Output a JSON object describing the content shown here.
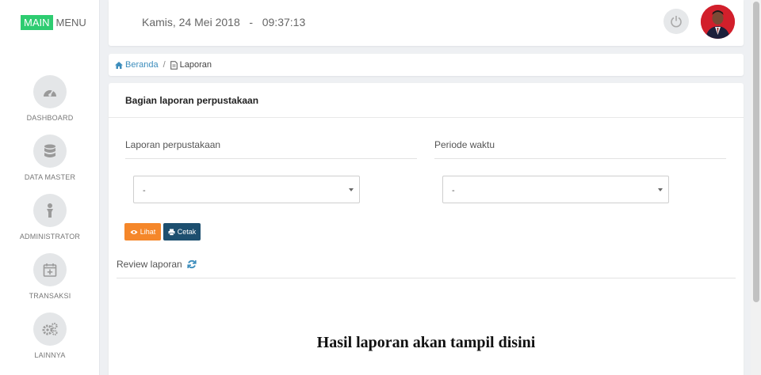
{
  "brand": {
    "main": "MAIN",
    "menu": "MENU"
  },
  "sidebar": {
    "items": [
      {
        "label": "DASHBOARD",
        "icon": "dashboard-gauge-icon"
      },
      {
        "label": "DATA MASTER",
        "icon": "database-icon"
      },
      {
        "label": "ADMINISTRATOR",
        "icon": "user-icon"
      },
      {
        "label": "TRANSAKSI",
        "icon": "calendar-plus-icon"
      },
      {
        "label": "LAINNYA",
        "icon": "gears-icon"
      }
    ]
  },
  "header": {
    "datetime": "Kamis, 24 Mei 2018   -   09:37:13"
  },
  "breadcrumb": {
    "home": "Beranda",
    "separator": "/",
    "current": "Laporan"
  },
  "panel": {
    "title": "Bagian laporan perpustakaan",
    "report_label": "Laporan perpustakaan",
    "report_value": "-",
    "period_label": "Periode waktu",
    "period_value": "-",
    "btn_lihat": "Lihat",
    "btn_cetak": "Cetak",
    "review_label": "Review laporan",
    "result_text": "Hasil laporan akan tampil disini"
  },
  "colors": {
    "brand_green": "#2ecc71",
    "link_blue": "#3c8dbc",
    "lihat_orange": "#f5872a",
    "cetak_navy": "#1d4f6f"
  }
}
